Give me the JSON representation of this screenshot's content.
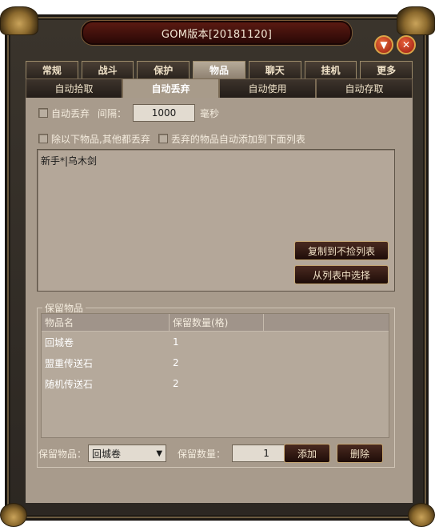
{
  "window": {
    "title": "GOM版本[20181120]"
  },
  "top_tabs": [
    {
      "label": "常规"
    },
    {
      "label": "战斗"
    },
    {
      "label": "保护"
    },
    {
      "label": "物品"
    },
    {
      "label": "聊天"
    },
    {
      "label": "挂机"
    },
    {
      "label": "更多"
    }
  ],
  "sub_tabs": [
    {
      "label": "自动拾取"
    },
    {
      "label": "自动丢弃"
    },
    {
      "label": "自动使用"
    },
    {
      "label": "自动存取"
    }
  ],
  "auto_drop": {
    "checkbox_label": "自动丢弃",
    "interval_label": "间隔：",
    "interval_value": "1000",
    "interval_unit": "毫秒"
  },
  "options": {
    "except_label": "除以下物品,其他都丢弃",
    "auto_add_label": "丢弃的物品自动添加到下面列表"
  },
  "drop_list_text": "新手*|乌木剑",
  "buttons": {
    "copy_to_nopick": "复制到不捡列表",
    "select_from_list": "从列表中选择",
    "add": "添加",
    "delete": "删除"
  },
  "keep_items": {
    "group_title": "保留物品",
    "columns": [
      "物品名",
      "保留数量(格)",
      ""
    ],
    "rows": [
      {
        "name": "回城卷",
        "count": "1"
      },
      {
        "name": "盟重传送石",
        "count": "2"
      },
      {
        "name": "随机传送石",
        "count": "2"
      }
    ],
    "item_label": "保留物品：",
    "item_selected": "回城卷",
    "qty_label": "保留数量：",
    "qty_value": "1"
  }
}
